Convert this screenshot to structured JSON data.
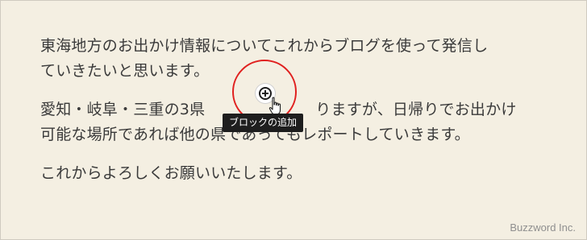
{
  "editor": {
    "paragraphs": [
      {
        "lines": [
          "東海地方のお出かけ情報についてこれからブログを使って発信し",
          "ていきたいと思います。"
        ]
      },
      {
        "lines": [
          "愛知・岐阜・三重の3県",
          "可能な場所であれば他の県であってもレポートしていきます。"
        ],
        "visible_tail": "りますが、日帰りでお出かけ"
      },
      {
        "lines": [
          "これからよろしくお願いいたします。"
        ]
      }
    ]
  },
  "inserter": {
    "icon": "plus-circle-icon",
    "tooltip": "ブロックの追加"
  },
  "annotation": {
    "highlight_color": "#e0201f"
  },
  "watermark": "Buzzword Inc."
}
